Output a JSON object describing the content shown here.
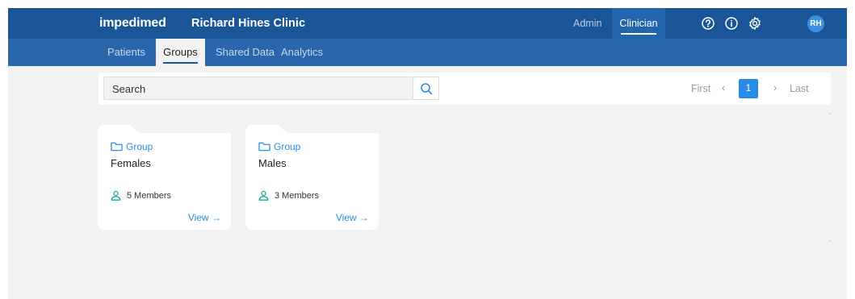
{
  "header": {
    "brand": "impedimed",
    "clinic": "Richard Hines Clinic",
    "roles": {
      "admin": "Admin",
      "clinician": "Clinician"
    },
    "user_initials": "RH",
    "icons": [
      "help-circle-icon",
      "info-icon",
      "gear-icon"
    ]
  },
  "nav": {
    "tabs": [
      {
        "label": "Patients"
      },
      {
        "label": "Groups",
        "active": true
      },
      {
        "label": "Shared Data"
      },
      {
        "label": "Analytics"
      }
    ]
  },
  "search": {
    "placeholder": "Search"
  },
  "pagination": {
    "first": "First",
    "prev": "‹",
    "current": "1",
    "next": "›",
    "last": "Last"
  },
  "groups": [
    {
      "tag": "Group",
      "name": "Females",
      "members": "5 Members",
      "action": "View →"
    },
    {
      "tag": "Group",
      "name": "Males",
      "members": "3 Members",
      "action": "View →"
    }
  ],
  "colors": {
    "header": "#1a5597",
    "subnav": "#2a66ab",
    "accent": "#2a8ce6",
    "member_icon": "#1aa8a0"
  }
}
